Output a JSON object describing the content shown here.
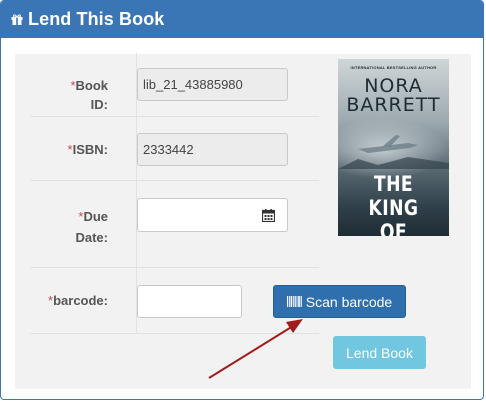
{
  "header": {
    "title": "Lend This Book",
    "icon": "gift-icon"
  },
  "form": {
    "book_id": {
      "label_line1": "Book",
      "label_line2": "ID:",
      "required_mark": "*",
      "value": "lib_21_43885980"
    },
    "isbn": {
      "label": "ISBN:",
      "required_mark": "*",
      "value": "2333442"
    },
    "due_date": {
      "label_line1": "Due",
      "label_line2": "Date:",
      "required_mark": "*",
      "value": "",
      "icon": "calendar-icon"
    },
    "barcode": {
      "label": "barcode:",
      "required_mark": "*",
      "value": ""
    }
  },
  "buttons": {
    "scan_barcode": "Scan barcode",
    "lend_book": "Lend Book"
  },
  "cover": {
    "tagline": "INTERNATIONAL BESTSELLING AUTHOR",
    "author_line1": "NORA",
    "author_line2": "BARRETT",
    "title_line1": "THE KING",
    "title_line2": "OF DRUGS"
  },
  "colors": {
    "header": "#3a76b6",
    "scan_button": "#2f6fae",
    "lend_button": "#5bc0de",
    "arrow": "#a31c1c",
    "required": "#c84a4a"
  }
}
